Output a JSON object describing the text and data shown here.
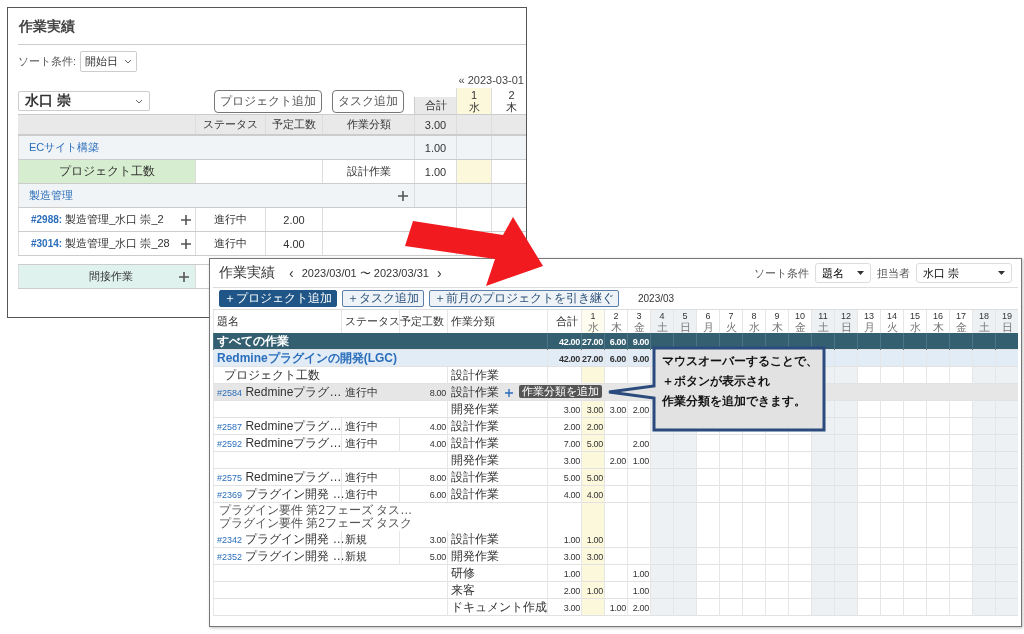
{
  "back_window": {
    "title": "作業実績",
    "sort_label": "ソート条件:",
    "sort_value": "開始日",
    "date_nav": "« 2023-03-01",
    "assignee": "水口 崇",
    "buttons": [
      "プロジェクト追加",
      "タスク追加"
    ],
    "total_label": "合計",
    "days": [
      {
        "day": "1",
        "weekday": "水",
        "today": true
      },
      {
        "day": "2",
        "weekday": "木",
        "today": false
      }
    ],
    "columns": [
      "ステータス",
      "予定工数",
      "作業分類"
    ],
    "header_total": "3.00",
    "rows": [
      {
        "kind": "project",
        "name": "ECサイト構築",
        "add": false,
        "total": "1.00"
      },
      {
        "kind": "project_hours",
        "name": "プロジェクト工数",
        "category": "設計作業",
        "total": "1.00"
      },
      {
        "kind": "project",
        "name": "製造管理",
        "add": true
      },
      {
        "kind": "task",
        "id": "#2988:",
        "name": "製造管理_水口 崇_2",
        "status": "進行中",
        "planned": "2.00"
      },
      {
        "kind": "task",
        "id": "#3014:",
        "name": "製造管理_水口 崇_28",
        "status": "進行中",
        "planned": "4.00"
      },
      {
        "kind": "indirect",
        "name": "間接作業"
      }
    ]
  },
  "front_window": {
    "title": "作業実績",
    "prev": "‹",
    "date_range": "2023/03/01 〜 2023/03/31",
    "next": "›",
    "sort_label": "ソート条件",
    "sort_value": "題名",
    "assignee_label": "担当者",
    "assignee": "水口 崇",
    "buttons": [
      {
        "label": "＋プロジェクト追加",
        "kind": "primary"
      },
      {
        "label": "＋タスク追加",
        "kind": "secondary"
      },
      {
        "label": "＋前月のプロジェクトを引き継ぐ",
        "kind": "secondary"
      }
    ],
    "month": "2023/03",
    "columns": [
      "題名",
      "ステータス",
      "予定工数",
      "作業分類",
      "合計"
    ],
    "days": [
      {
        "day": "1",
        "weekday": "水",
        "weekend": false,
        "today": true
      },
      {
        "day": "2",
        "weekday": "木",
        "weekend": false,
        "today": false
      },
      {
        "day": "3",
        "weekday": "金",
        "weekend": false,
        "today": false
      },
      {
        "day": "4",
        "weekday": "土",
        "weekend": true,
        "today": false
      },
      {
        "day": "5",
        "weekday": "日",
        "weekend": true,
        "today": false
      },
      {
        "day": "6",
        "weekday": "月",
        "weekend": false,
        "today": false
      },
      {
        "day": "7",
        "weekday": "火",
        "weekend": false,
        "today": false
      },
      {
        "day": "8",
        "weekday": "水",
        "weekend": false,
        "today": false
      },
      {
        "day": "9",
        "weekday": "木",
        "weekend": false,
        "today": false
      },
      {
        "day": "10",
        "weekday": "金",
        "weekend": false,
        "today": false
      },
      {
        "day": "11",
        "weekday": "土",
        "weekend": true,
        "today": false
      },
      {
        "day": "12",
        "weekday": "日",
        "weekend": true,
        "today": false
      },
      {
        "day": "13",
        "weekday": "月",
        "weekend": false,
        "today": false
      },
      {
        "day": "14",
        "weekday": "火",
        "weekend": false,
        "today": false
      },
      {
        "day": "15",
        "weekday": "水",
        "weekend": false,
        "today": false
      },
      {
        "day": "16",
        "weekday": "木",
        "weekend": false,
        "today": false
      },
      {
        "day": "17",
        "weekday": "金",
        "weekend": false,
        "today": false
      },
      {
        "day": "18",
        "weekday": "土",
        "weekend": true,
        "today": false
      },
      {
        "day": "19",
        "weekday": "日",
        "weekend": true,
        "today": false
      }
    ],
    "rows": [
      {
        "kind": "all",
        "name": "すべての作業",
        "total": "42.00",
        "values": {
          "0": "27.00",
          "1": "6.00",
          "2": "9.00"
        }
      },
      {
        "kind": "project",
        "name": "Redmineプラグインの開発(LGC)",
        "total": "42.00",
        "values": {
          "0": "27.00",
          "1": "6.00",
          "2": "9.00"
        }
      },
      {
        "kind": "project_hours",
        "name": "プロジェクト工数",
        "category": "設計作業"
      },
      {
        "kind": "task",
        "id": "#2584",
        "name": "Redmineプラグ…",
        "status": "進行中",
        "planned": "8.00",
        "category": "設計作業",
        "hover": true,
        "tooltip": "作業分類を追加"
      },
      {
        "kind": "category",
        "category": "開発作業",
        "total": "3.00",
        "values": {
          "0": "3.00",
          "1": "3.00",
          "2": "2.00"
        }
      },
      {
        "kind": "task",
        "id": "#2587",
        "name": "Redmineプラグ…",
        "status": "進行中",
        "planned": "4.00",
        "category": "設計作業",
        "hover": false,
        "total": "2.00",
        "values": {
          "0": "2.00"
        }
      },
      {
        "kind": "task",
        "id": "#2592",
        "name": "Redmineプラグ…",
        "status": "進行中",
        "planned": "4.00",
        "category": "設計作業",
        "hover": false,
        "total": "7.00",
        "values": {
          "0": "5.00",
          "2": "2.00"
        }
      },
      {
        "kind": "category",
        "category": "開発作業",
        "total": "3.00",
        "values": {
          "1": "2.00",
          "2": "1.00"
        }
      },
      {
        "kind": "task",
        "id": "#2575",
        "name": "Redmineプラグ…",
        "status": "進行中",
        "planned": "8.00",
        "category": "設計作業",
        "hover": false,
        "total": "5.00",
        "values": {
          "0": "5.00"
        }
      },
      {
        "kind": "task",
        "id": "#2369",
        "name": "プラグイン開発 …",
        "status": "進行中",
        "planned": "6.00",
        "category": "設計作業",
        "hover": false,
        "total": "4.00",
        "values": {
          "0": "4.00"
        }
      },
      {
        "kind": "task",
        "parents": [
          "プラグイン要件 第2フェーズ タス…",
          "プラグイン要件 第2フェーズ タスク"
        ],
        "id": "#2342",
        "name": "プラグイン開発 …",
        "status": "新規",
        "planned": "3.00",
        "category": "設計作業",
        "hover": false,
        "total": "1.00",
        "values": {
          "0": "1.00"
        }
      },
      {
        "kind": "task",
        "id": "#2352",
        "name": "プラグイン開発 …",
        "status": "新規",
        "planned": "5.00",
        "category": "開発作業",
        "hover": false,
        "total": "3.00",
        "values": {
          "0": "3.00"
        }
      },
      {
        "kind": "category",
        "category": "研修",
        "total": "1.00",
        "values": {
          "2": "1.00"
        }
      },
      {
        "kind": "category",
        "category": "来客",
        "total": "2.00",
        "values": {
          "0": "1.00",
          "2": "1.00"
        }
      },
      {
        "kind": "category",
        "category": "ドキュメント作成",
        "total": "3.00",
        "values": {
          "1": "1.00",
          "2": "2.00"
        }
      }
    ]
  },
  "callout": {
    "lines": [
      "マウスオーバーすることで、",
      "＋ボタンが表示され",
      "作業分類を追加できます。"
    ]
  }
}
